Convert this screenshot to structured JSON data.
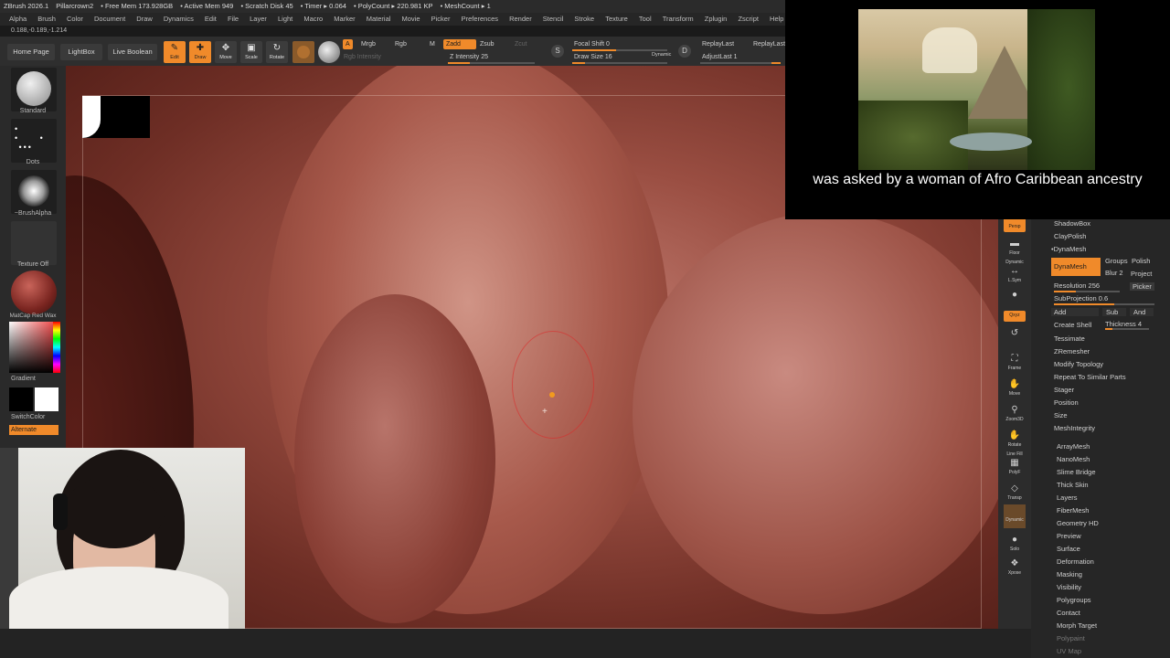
{
  "titlebar": {
    "items": [
      "ZBrush 2026.1",
      "Pillarcrown2",
      "• Free Mem 173.928GB",
      "• Active Mem 949",
      "• Scratch Disk 45",
      "• Timer ▸ 0.064",
      "• PolyCount ▸ 220.981 KP",
      "• MeshCount ▸ 1"
    ]
  },
  "menubar": {
    "items": [
      "Alpha",
      "Brush",
      "Color",
      "Document",
      "Draw",
      "Dynamics",
      "Edit",
      "File",
      "Layer",
      "Light",
      "Macro",
      "Marker",
      "Material",
      "Movie",
      "Picker",
      "Preferences",
      "Render",
      "Stencil",
      "Stroke",
      "Texture",
      "Tool",
      "Transform",
      "Zplugin",
      "Zscript",
      "Help"
    ]
  },
  "coords": "0.188,-0.189,-1.214",
  "shelf": {
    "home_page": "Home Page",
    "lightbox": "LightBox",
    "live_boolean": "Live Boolean",
    "edit": "Edit",
    "draw": "Draw",
    "move": "Move",
    "scale": "Scale",
    "rotate": "Rotate",
    "a_label": "A",
    "mrgb": "Mrgb",
    "rgb": "Rgb",
    "m": "M",
    "zadd": "Zadd",
    "zsub": "Zsub",
    "zcut": "Zcut",
    "rgb_intensity": "Rgb Intensity",
    "z_intensity": "Z Intensity 25",
    "focal_shift": "Focal Shift 0",
    "draw_size": "Draw Size 16",
    "dynamic": "Dynamic",
    "replay_last": "ReplayLast",
    "replay_last_rel": "ReplayLast",
    "adjust_last": "AdjustLast 1",
    "s_label": "S",
    "d_label": "D"
  },
  "leftshelf": {
    "standard": "Standard",
    "dots": "Dots",
    "brush_alpha": "~BrushAlpha",
    "texture_off": "Texture Off",
    "matcap": "MatCap Red Wax",
    "gradient": "Gradient",
    "switch_color": "SwitchColor",
    "alternate": "Alternate"
  },
  "rightshelf": {
    "persp": "Persp",
    "floor": "Floor",
    "dynamic": "Dynamic",
    "lsym": "L.Sym",
    "xyz": "Qxyz",
    "frame": "Frame",
    "move": "Move",
    "zoom3d": "Zoom3D",
    "rotate": "Rotate",
    "line_fill": "Line Fill",
    "polyf": "PolyF",
    "transp": "Transp",
    "dynamic2": "Dynamic",
    "solo": "Solo",
    "xpose": "Xpose"
  },
  "toolpanel": {
    "shadowbox": "ShadowBox",
    "claypolish": "ClayPolish",
    "dynamesh_header": "•DynaMesh",
    "dynamesh_btn": "DynaMesh",
    "groups": "Groups",
    "polish": "Polish",
    "blur": "Blur 2",
    "project": "Project",
    "resolution": "Resolution 256",
    "picker": "Picker",
    "subprojection": "SubProjection 0.6",
    "add": "Add",
    "sub": "Sub",
    "and": "And",
    "create_shell": "Create Shell",
    "thickness": "Thickness 4",
    "tessimate": "Tessimate",
    "zremesher": "ZRemesher",
    "modify_topology": "Modify Topology",
    "repeat_similar": "Repeat To Similar Parts",
    "stager": "Stager",
    "position": "Position",
    "size": "Size",
    "meshintegrity": "MeshIntegrity",
    "arraymesh": "ArrayMesh",
    "nanomesh": "NanoMesh",
    "slime_bridge": "Slime Bridge",
    "thick_skin": "Thick Skin",
    "layers": "Layers",
    "fibermesh": "FiberMesh",
    "geometry_hd": "Geometry HD",
    "preview": "Preview",
    "surface": "Surface",
    "deformation": "Deformation",
    "masking": "Masking",
    "visibility": "Visibility",
    "polygroups": "Polygroups",
    "contact": "Contact",
    "morph_target": "Morph Target",
    "polypaint": "Polypaint",
    "uv_map": "UV Map"
  },
  "overlay": {
    "caption": "was asked by a woman of Afro Caribbean ancestry"
  },
  "colors": {
    "accent": "#f08a2a",
    "panel": "#2a2a2a",
    "mesh": "#9a4e42"
  }
}
